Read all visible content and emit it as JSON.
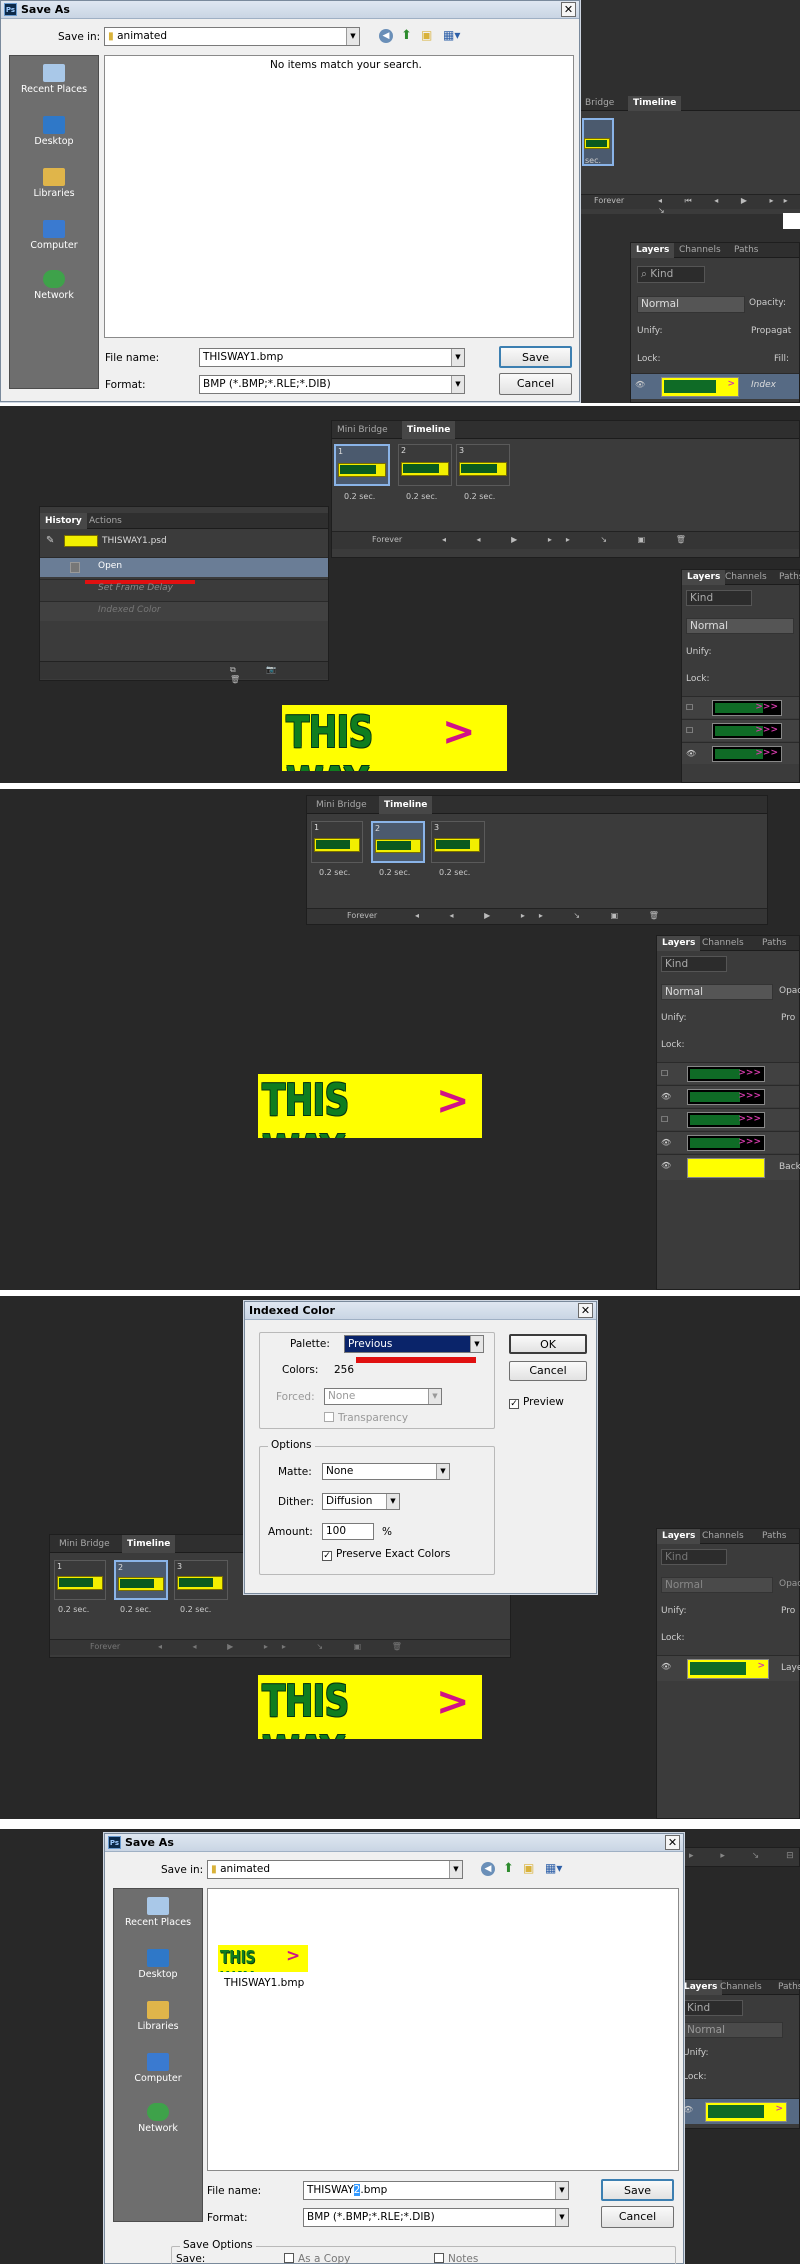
{
  "app": "Adobe Photoshop",
  "colors": {
    "banner_bg": "#ffff00",
    "banner_text": "#0f7d1f",
    "arrow": "#d01287",
    "selection": "#0a246a",
    "red_annotation": "#e01010"
  },
  "save_dialog": {
    "title": "Save As",
    "save_in_label": "Save in:",
    "folder": "animated",
    "empty_message": "No items match your search.",
    "places": [
      "Recent Places",
      "Desktop",
      "Libraries",
      "Computer",
      "Network"
    ],
    "file_name_label": "File name:",
    "file_name": "THISWAY1.bmp",
    "format_label": "Format:",
    "format": "BMP (*.BMP;*.RLE;*.DIB)",
    "save_button": "Save",
    "cancel_button": "Cancel"
  },
  "panel_tabs": {
    "mini_bridge": "Mini Bridge",
    "timeline": "Timeline",
    "mini_bridge_short": "Bridge"
  },
  "layers_tabs": {
    "layers": "Layers",
    "channels": "Channels",
    "paths": "Paths"
  },
  "layers_panel": {
    "kind": "Kind",
    "blend": "Normal",
    "opacity_label": "Opacity:",
    "opacity_short": "Opac",
    "unify_label": "Unify:",
    "propagate": "Propagat",
    "propagate_short": "Pro",
    "lock_label": "Lock:",
    "fill_label": "Fill:",
    "index_layer": "Index",
    "layer_name": "Layer",
    "bg_name": "Back"
  },
  "timeline": {
    "frames": [
      {
        "num": "1",
        "delay": "0.2 sec."
      },
      {
        "num": "2",
        "delay": "0.2 sec."
      },
      {
        "num": "3",
        "delay": "0.2 sec."
      }
    ],
    "loop": "Forever",
    "partial_delay": "sec."
  },
  "history": {
    "tabs": [
      "History",
      "Actions"
    ],
    "doc": "THISWAY1.psd",
    "items": [
      "Open",
      "Set Frame Delay",
      "Indexed Color"
    ]
  },
  "banner": {
    "text": "THIS WAY",
    "arrow": ">"
  },
  "indexed_dialog": {
    "title": "Indexed Color",
    "palette_label": "Palette:",
    "palette": "Previous",
    "colors_label": "Colors:",
    "colors": "256",
    "forced_label": "Forced:",
    "forced": "None",
    "transparency": "Transparency",
    "options_label": "Options",
    "matte_label": "Matte:",
    "matte": "None",
    "dither_label": "Dither:",
    "dither": "Diffusion",
    "amount_label": "Amount:",
    "amount": "100",
    "amount_unit": "%",
    "preserve": "Preserve Exact Colors",
    "ok": "OK",
    "cancel": "Cancel",
    "preview": "Preview"
  },
  "save_dialog2": {
    "title": "Save As",
    "save_in_label": "Save in:",
    "folder": "animated",
    "file_item": "THISWAY1.bmp",
    "places": [
      "Recent Places",
      "Desktop",
      "Libraries",
      "Computer",
      "Network"
    ],
    "file_name_label": "File name:",
    "file_name_prefix": "THISWAY",
    "file_name_sel": "2",
    "file_name_suffix": ".bmp",
    "format_label": "Format:",
    "format": "BMP (*.BMP;*.RLE;*.DIB)",
    "save_button": "Save",
    "cancel_button": "Cancel",
    "options_label": "Save Options",
    "save_label": "Save:",
    "as_copy": "As a Copy",
    "notes": "Notes"
  }
}
